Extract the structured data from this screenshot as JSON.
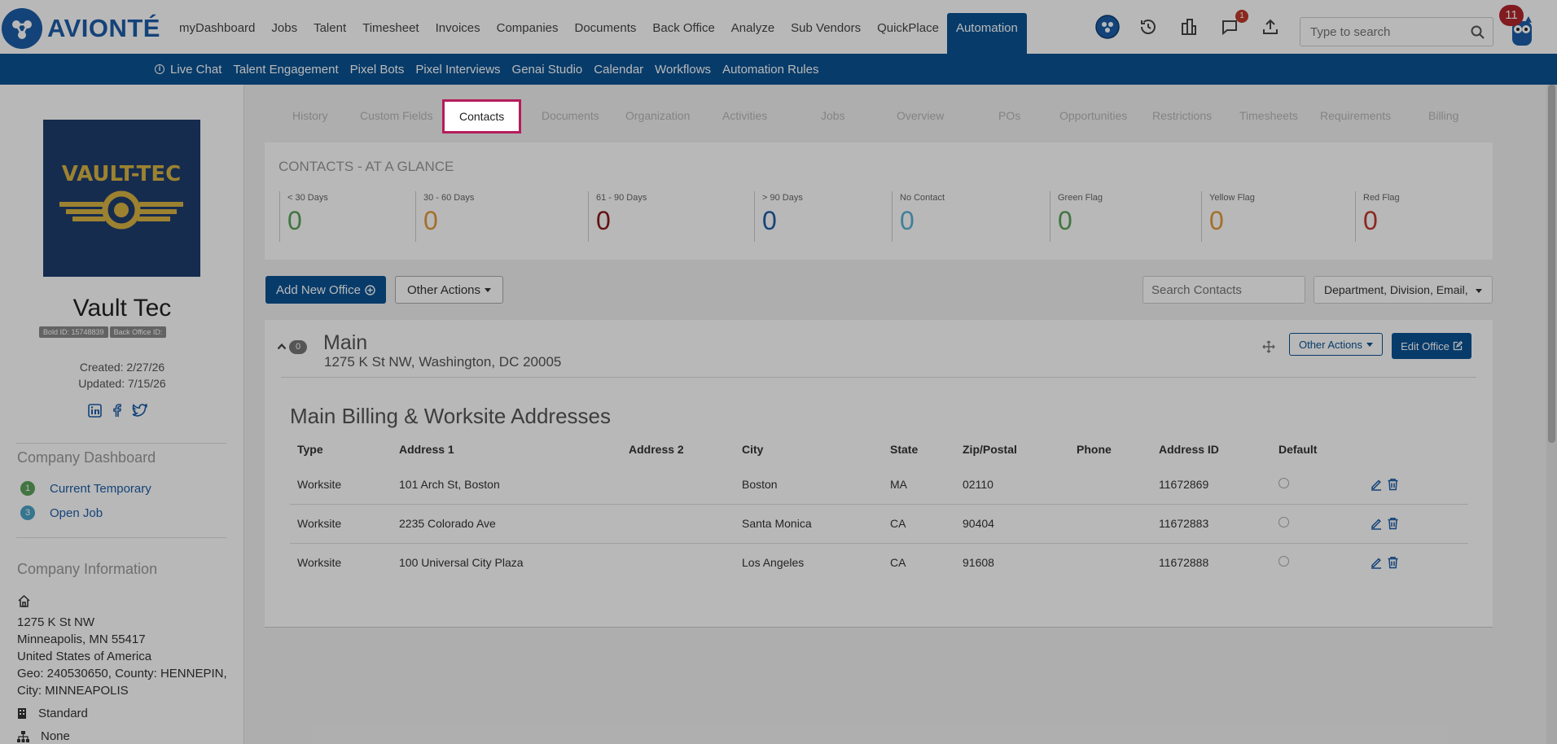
{
  "brand": {
    "name": "AVIONTÉ",
    "color": "#1d5ea8"
  },
  "main_menu": [
    "myDashboard",
    "Jobs",
    "Talent",
    "Timesheet",
    "Invoices",
    "Companies",
    "Documents",
    "Back Office",
    "Analyze",
    "Sub Vendors",
    "QuickPlace",
    "Automation"
  ],
  "main_menu_active": "Automation",
  "top_icons": {
    "chat_badge": "1",
    "avatar_badge": "11"
  },
  "top_search": {
    "placeholder": "Type to search"
  },
  "sub_menu": [
    "Live Chat",
    "Talent Engagement",
    "Pixel Bots",
    "Pixel Interviews",
    "Genai Studio",
    "Calendar",
    "Workflows",
    "Automation Rules"
  ],
  "company": {
    "logo_text": "VAULT-TEC",
    "name": "Vault Tec",
    "bold_id": "Bold ID: 15748839",
    "back_office_id": "Back Office ID:",
    "created": "Created: 2/27/26",
    "updated": "Updated: 7/15/26"
  },
  "company_dashboard": {
    "title": "Company Dashboard",
    "items": [
      {
        "count": "1",
        "label": "Current Temporary",
        "color": "#5aa35a"
      },
      {
        "count": "3",
        "label": "Open Job",
        "color": "#4aa3c7"
      }
    ]
  },
  "company_info": {
    "title": "Company Information",
    "address_lines": [
      "1275 K St NW",
      "Minneapolis, MN 55417",
      "United States of America",
      "Geo: 240530650, County: HENNEPIN,",
      "City: MINNEAPOLIS"
    ],
    "type": "Standard",
    "parent": "None"
  },
  "tabs": [
    "History",
    "Custom Fields",
    "Contacts",
    "Documents",
    "Organization",
    "Activities",
    "Jobs",
    "Overview",
    "POs",
    "Opportunities",
    "Restrictions",
    "Timesheets",
    "Requirements",
    "Billing"
  ],
  "active_tab": "Contacts",
  "glance": {
    "title": "CONTACTS - AT A GLANCE",
    "stats": [
      {
        "label": "< 30 Days",
        "value": "0",
        "color": "#5aa35a"
      },
      {
        "label": "30 - 60 Days",
        "value": "0",
        "color": "#e39a3b"
      },
      {
        "label": "61 - 90 Days",
        "value": "0",
        "color": "#8b1a1a"
      },
      {
        "label": "> 90 Days",
        "value": "0",
        "color": "#1d5ea8"
      },
      {
        "label": "No Contact",
        "value": "0",
        "color": "#5ab0d6"
      },
      {
        "label": "Green Flag",
        "value": "0",
        "color": "#5aa35a"
      },
      {
        "label": "Yellow Flag",
        "value": "0",
        "color": "#e39a3b"
      },
      {
        "label": "Red Flag",
        "value": "0",
        "color": "#c0392b"
      }
    ]
  },
  "actions": {
    "add_office": "Add New Office",
    "other_actions": "Other Actions",
    "search_placeholder": "Search Contacts",
    "filter_value": "Department, Division, Email,"
  },
  "office": {
    "count": "0",
    "name": "Main",
    "address": "1275 K St NW, Washington, DC 20005",
    "other_actions": "Other Actions",
    "edit": "Edit Office",
    "section_title": "Main Billing & Worksite Addresses",
    "columns": [
      "Type",
      "Address 1",
      "Address 2",
      "City",
      "State",
      "Zip/Postal",
      "Phone",
      "Address ID",
      "Default",
      ""
    ],
    "rows": [
      [
        "Worksite",
        "101 Arch St, Boston",
        "",
        "Boston",
        "MA",
        "02110",
        "",
        "11672869"
      ],
      [
        "Worksite",
        "2235 Colorado Ave",
        "",
        "Santa Monica",
        "CA",
        "90404",
        "",
        "11672883"
      ],
      [
        "Worksite",
        "100 Universal City Plaza",
        "",
        "Los Angeles",
        "CA",
        "91608",
        "",
        "11672888"
      ]
    ]
  }
}
